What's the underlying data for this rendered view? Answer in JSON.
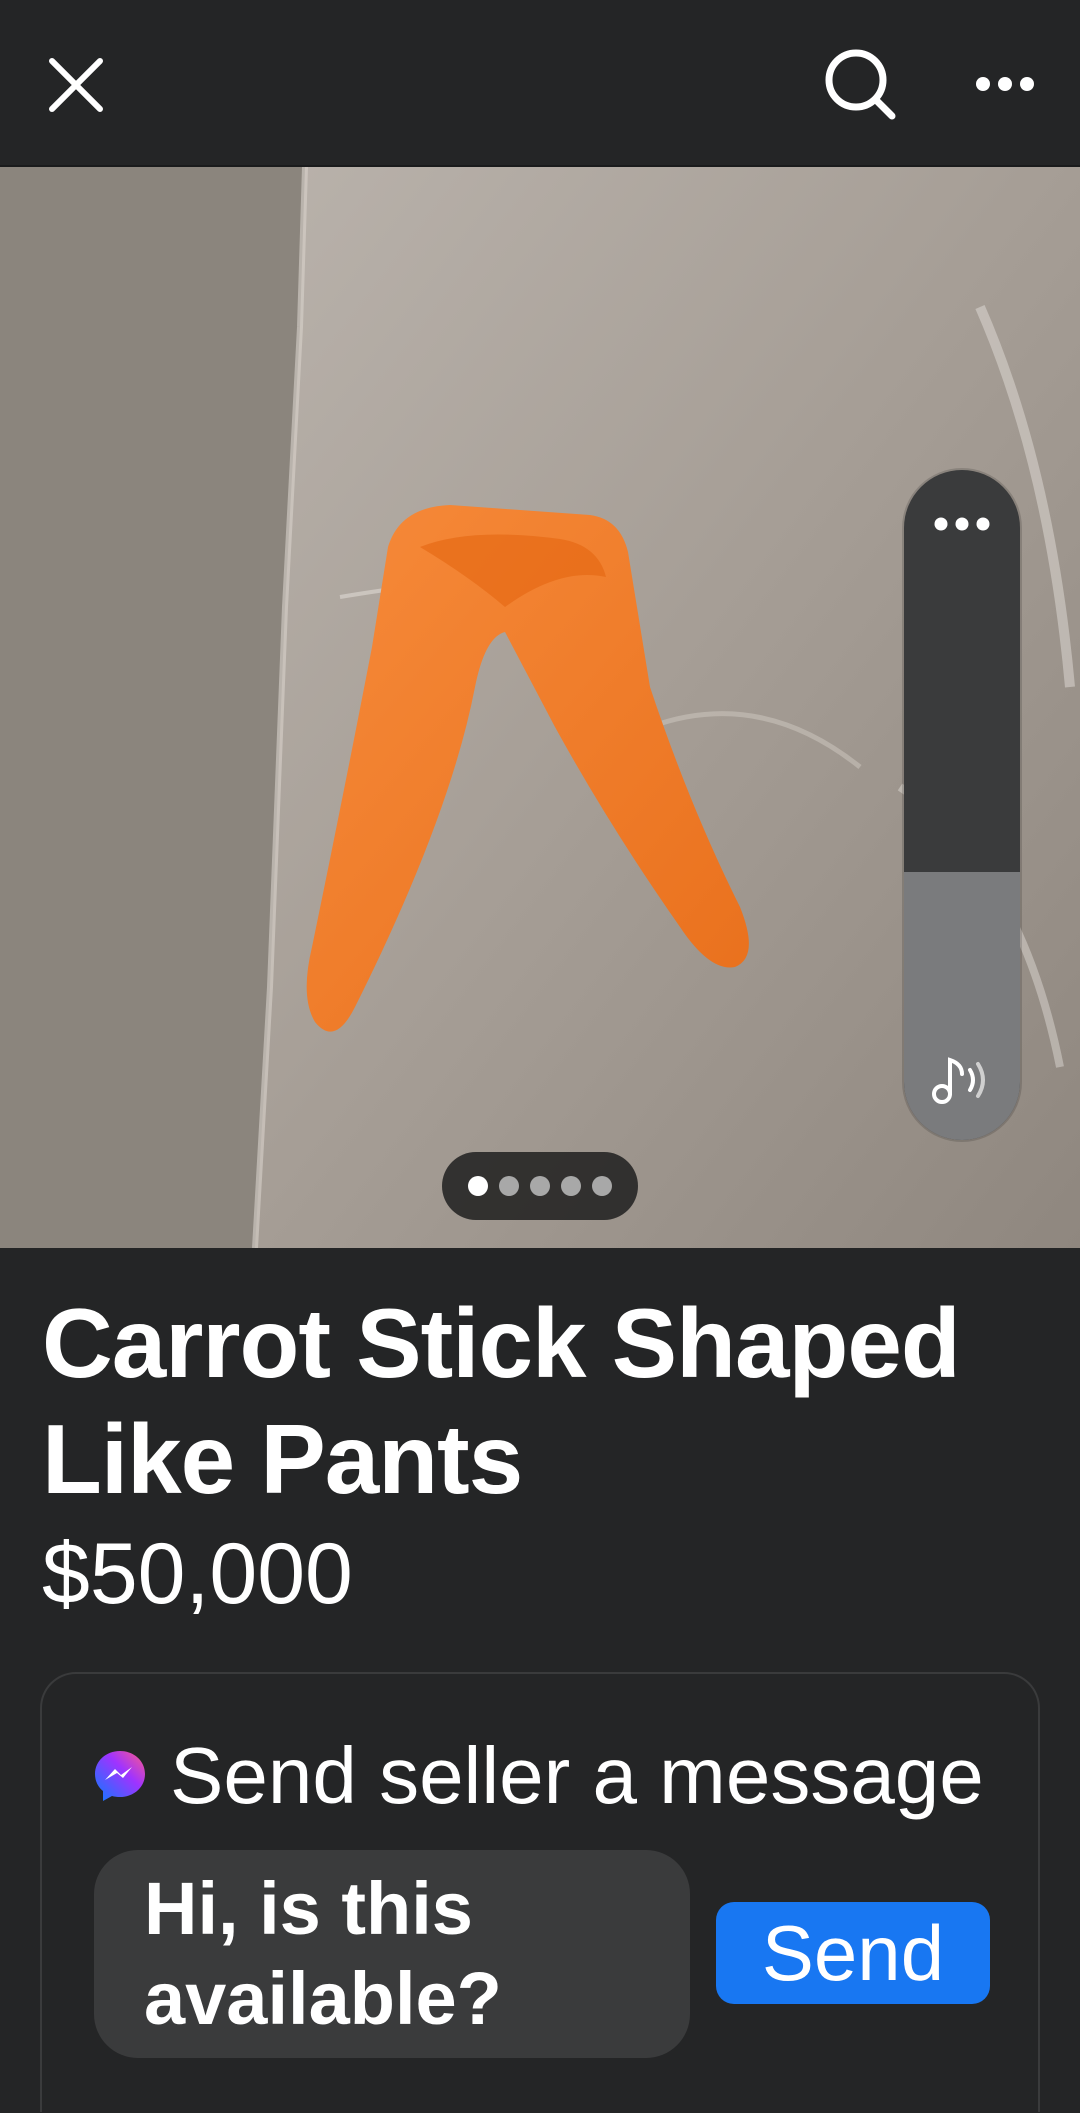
{
  "header": {
    "close_icon": "close-icon",
    "search_icon": "search-icon",
    "more_icon": "more-horizontal-icon"
  },
  "photo": {
    "subject": "",
    "page_count": 5,
    "current_page": 1
  },
  "volume": {
    "level": 0.4,
    "icon": "music-note-volume-icon",
    "menu_icon": "more-horizontal-icon"
  },
  "listing": {
    "title": "Carrot Stick Shaped Like Pants",
    "price": "$50,000"
  },
  "message": {
    "header_icon": "messenger-icon",
    "header_text": "Send seller a message",
    "input_value": "Hi, is this available?",
    "send_label": "Send"
  },
  "colors": {
    "background": "#242526",
    "accent": "#1877f2",
    "card_border": "#3a3b3c",
    "carrot": "#f07a24"
  }
}
